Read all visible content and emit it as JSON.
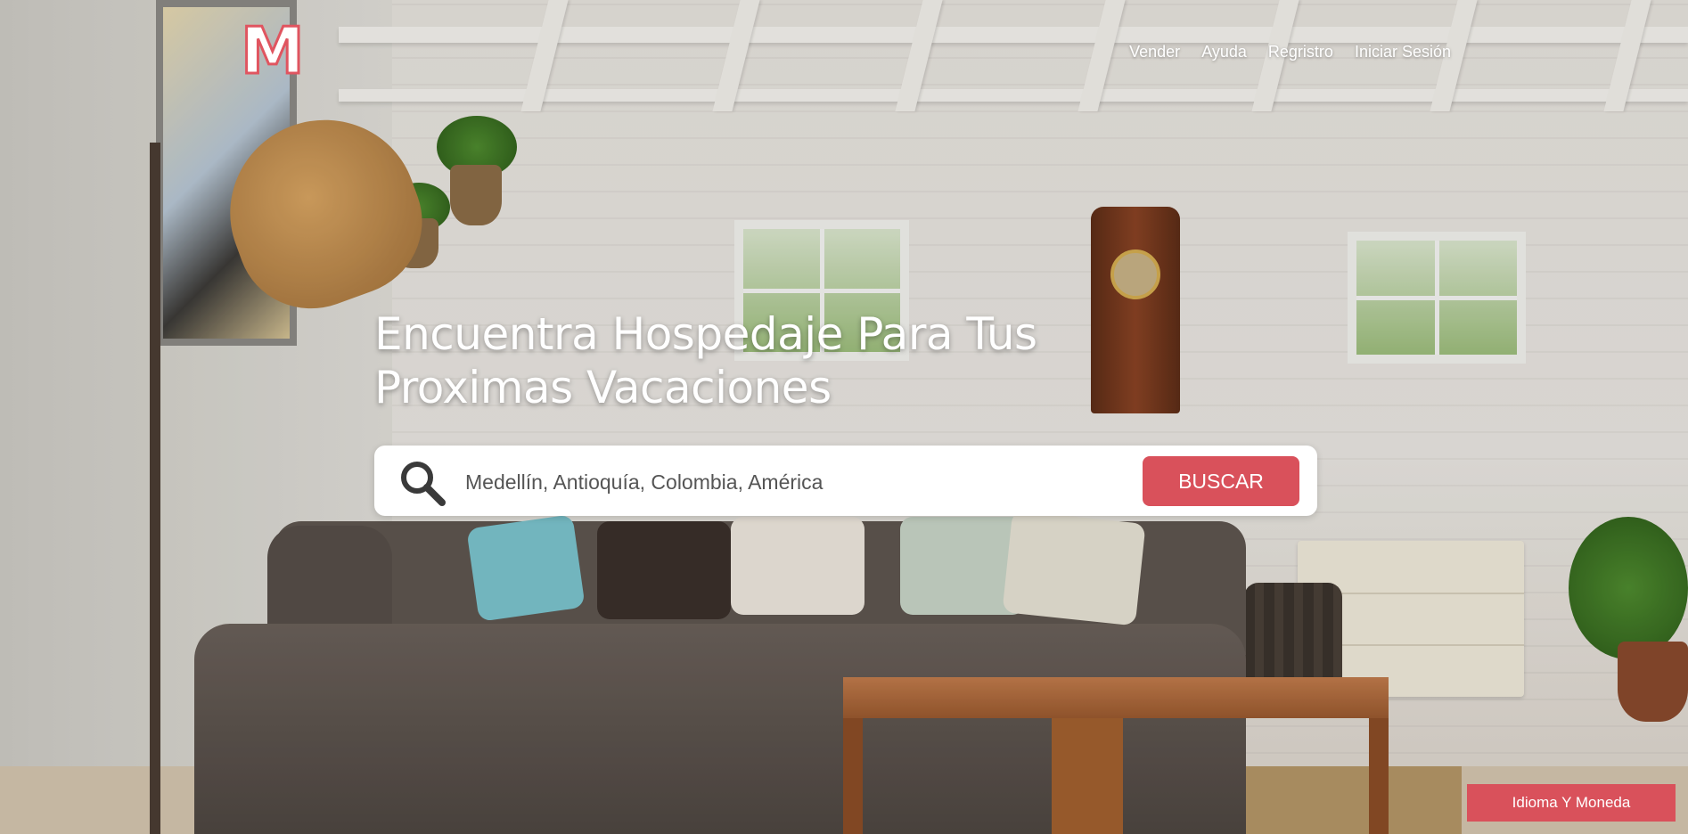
{
  "logo": {
    "letter": "M"
  },
  "nav": {
    "items": [
      {
        "label": "Vender"
      },
      {
        "label": "Ayuda"
      },
      {
        "label": "Regristro"
      },
      {
        "label": "Iniciar Sesión"
      }
    ]
  },
  "hero": {
    "title": "Encuentra Hospedaje Para Tus Proximas Vacaciones"
  },
  "search": {
    "placeholder": "Medellín, Antioquía, Colombia, América",
    "icon": "search-icon",
    "button_label": "BUSCAR"
  },
  "footer": {
    "language_currency_label": "Idioma Y Moneda"
  },
  "colors": {
    "accent": "#d9515b",
    "text_light": "#ffffff"
  }
}
